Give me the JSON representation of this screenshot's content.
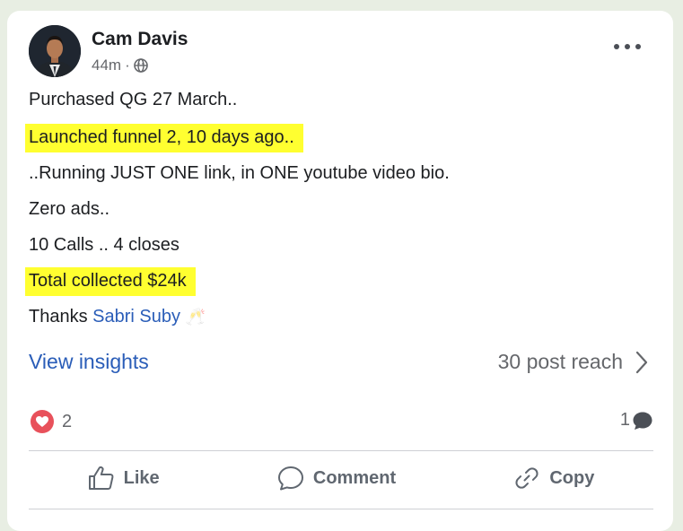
{
  "post": {
    "author": "Cam Davis",
    "time": "44m",
    "separator": "·",
    "audience_icon": "globe-icon",
    "lines": {
      "l1": "Purchased QG 27 March..",
      "l2": "Launched funnel 2, 10 days ago..",
      "l3": "..Running JUST ONE link, in ONE youtube video bio.",
      "l4": "Zero ads..",
      "l5": "10 Calls .. 4 closes",
      "l6": "Total collected $24k",
      "l7_prefix": "Thanks ",
      "l7_mention": "Sabri Suby",
      "l7_emoji": "🥂"
    },
    "highlight_color": "#ffff30"
  },
  "insights": {
    "label": "View insights",
    "reach": "30 post reach"
  },
  "stats": {
    "reactions_count": "2",
    "reaction_icon": "heart-icon",
    "comments_count": "1",
    "comment_icon": "comment-bubble-icon"
  },
  "actions": {
    "like": "Like",
    "comment": "Comment",
    "copy": "Copy"
  },
  "colors": {
    "link": "#2a5db8",
    "heart": "#e8515b"
  }
}
